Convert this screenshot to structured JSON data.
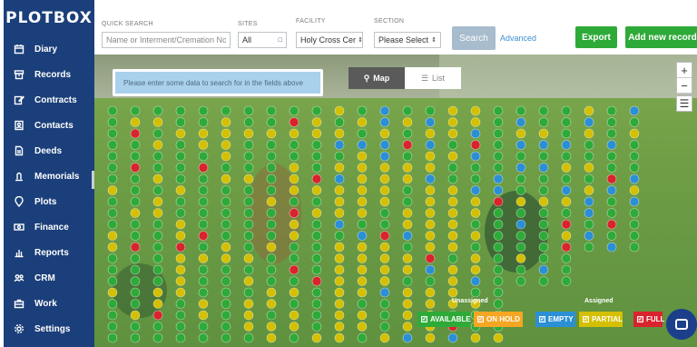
{
  "app": {
    "logo": "PLOTBOX"
  },
  "sidebar": {
    "items": [
      {
        "label": "Diary",
        "icon": "calendar-icon"
      },
      {
        "label": "Records",
        "icon": "archive-icon"
      },
      {
        "label": "Contracts",
        "icon": "edit-icon"
      },
      {
        "label": "Contacts",
        "icon": "contact-card-icon"
      },
      {
        "label": "Deeds",
        "icon": "document-icon"
      },
      {
        "label": "Memorials",
        "icon": "memorial-icon"
      },
      {
        "label": "Plots",
        "icon": "map-pin-icon"
      },
      {
        "label": "Finance",
        "icon": "money-icon"
      },
      {
        "label": "Reports",
        "icon": "bar-chart-icon"
      },
      {
        "label": "CRM",
        "icon": "users-icon"
      },
      {
        "label": "Work",
        "icon": "briefcase-icon"
      },
      {
        "label": "Settings",
        "icon": "gear-icon"
      }
    ]
  },
  "search": {
    "quick_label": "QUICK SEARCH",
    "quick_placeholder": "Name or Interment/Cremation No",
    "sites_label": "SITES",
    "sites_value": "All",
    "facility_label": "FACILITY",
    "facility_value": "Holy Cross Cer",
    "section_label": "SECTION",
    "section_value": "Please Select",
    "search_button": "Search",
    "advanced_link": "Advanced"
  },
  "actions": {
    "export": "Export",
    "add_new": "Add new record"
  },
  "map": {
    "info_message": "Please enter some data to search for in the fields above",
    "tabs": {
      "map": "Map",
      "list": "List"
    },
    "zoom_in": "+",
    "zoom_out": "−"
  },
  "legend": {
    "unassigned_label": "Unassigned",
    "assigned_label": "Assigned",
    "items": [
      {
        "label": "AVAILABLE",
        "color": "#2eaa39"
      },
      {
        "label": "ON HOLD",
        "color": "#f5a623"
      },
      {
        "label": "EMPTY",
        "color": "#2b8fd6"
      },
      {
        "label": "PARTIAL",
        "color": "#d4c000"
      },
      {
        "label": "FULL",
        "color": "#d9232d"
      }
    ]
  }
}
